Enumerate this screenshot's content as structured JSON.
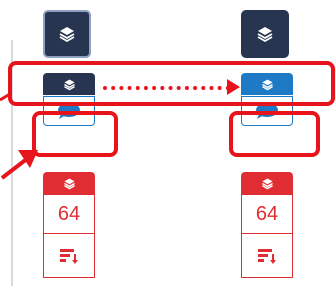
{
  "panels": {
    "left": {
      "top_icon": "layers-icon",
      "mid_icon": "layers-icon",
      "chat_icon": "chat-bubble-icon",
      "count": "64",
      "sort_icon": "sort-descending-icon"
    },
    "right": {
      "top_icon": "layers-icon",
      "mid_icon": "layers-icon",
      "chat_icon": "chat-bubble-icon",
      "count": "64",
      "sort_icon": "sort-descending-icon"
    }
  },
  "colors": {
    "dark_navy": "#283550",
    "active_blue": "#1e7ac4",
    "alert_red": "#e02d33",
    "annotation_red": "#e8141c"
  }
}
